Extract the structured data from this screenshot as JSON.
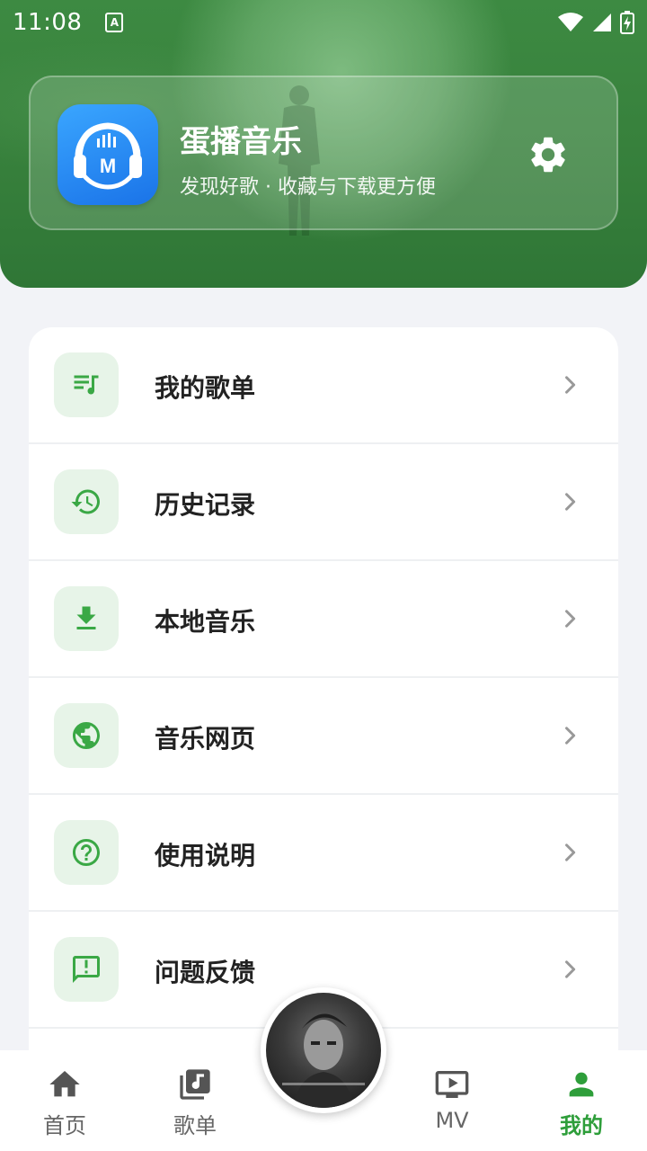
{
  "status": {
    "time": "11:08",
    "a_icon": "A"
  },
  "profile": {
    "app_name": "蛋播音乐",
    "tagline": "发现好歌 · 收藏与下载更方便"
  },
  "menu": [
    {
      "label": "我的歌单",
      "icon": "playlist-icon"
    },
    {
      "label": "历史记录",
      "icon": "history-icon"
    },
    {
      "label": "本地音乐",
      "icon": "download-icon"
    },
    {
      "label": "音乐网页",
      "icon": "globe-icon"
    },
    {
      "label": "使用说明",
      "icon": "help-icon"
    },
    {
      "label": "问题反馈",
      "icon": "feedback-icon"
    }
  ],
  "nav": [
    {
      "label": "首页",
      "icon": "home-icon",
      "active": false
    },
    {
      "label": "歌单",
      "icon": "playlist-library-icon",
      "active": false
    },
    {
      "label": "MV",
      "icon": "mv-icon",
      "active": false
    },
    {
      "label": "我的",
      "icon": "person-icon",
      "active": true
    }
  ],
  "colors": {
    "accent": "#2e9e3a",
    "header_green": "#367f3b",
    "icon_bg": "#e7f4e8"
  }
}
